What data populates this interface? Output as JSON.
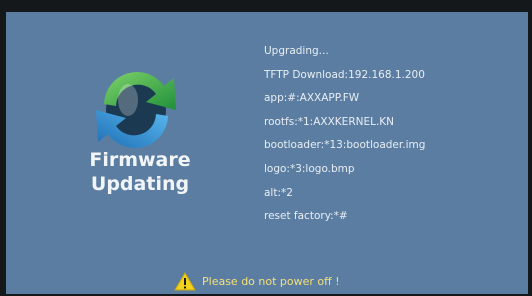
{
  "title": {
    "line1": "Firmware",
    "line2": "Updating"
  },
  "logo": {
    "icon": "sync-arrows-icon",
    "colors": {
      "green": "#34b44a",
      "blue": "#2f8fd6",
      "dark": "#1b3a52"
    }
  },
  "status_lines": [
    "Upgrading...",
    "TFTP Download:192.168.1.200",
    "app:#:AXXAPP.FW",
    "rootfs:*1:AXXKERNEL.KN",
    "bootloader:*13:bootloader.img",
    "logo:*3:logo.bmp",
    "alt:*2",
    "reset factory:*#"
  ],
  "warning": {
    "icon": "warning-triangle-icon",
    "text": "Please do not power off !",
    "color": "#f3e07a"
  },
  "colors": {
    "screen_bg": "#5b7da1",
    "text": "#e8eef4"
  }
}
